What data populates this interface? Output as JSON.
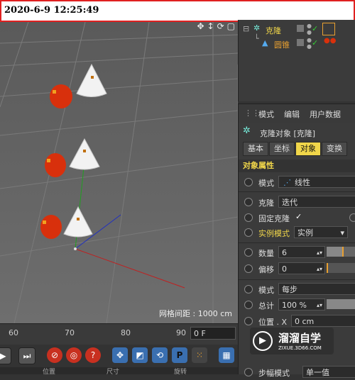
{
  "timestamp": "2020-6-9 12:25:49",
  "viewport": {
    "grid_label": "网格间距 : 1000 cm",
    "icons": [
      "move-view-icon",
      "vertical-arrows-icon",
      "rotate-view-icon",
      "maximize-icon"
    ]
  },
  "timeline": {
    "ticks": [
      "60",
      "70",
      "80",
      "90"
    ],
    "frame": "0 F"
  },
  "playback": {
    "buttons": [
      "record-icon",
      "end-icon",
      "keyframe-red-icon",
      "keyframe-record-icon",
      "help-icon",
      "move-tool-icon",
      "scale-tool-icon",
      "rotate-tool-icon",
      "p-tool-icon",
      "dots-grid-icon",
      "film-icon"
    ]
  },
  "bottom_strip": [
    "位置",
    "尺寸",
    "旋转"
  ],
  "object_manager": {
    "items": [
      {
        "label": "克隆",
        "icon": "cloner-icon"
      },
      {
        "label": "圆锥",
        "icon": "cone-icon"
      }
    ]
  },
  "attr_menu": [
    "模式",
    "编辑",
    "用户数据"
  ],
  "attr_title": "克隆对象 [克隆]",
  "tabs": [
    {
      "label": "基本",
      "active": false
    },
    {
      "label": "坐标",
      "active": false
    },
    {
      "label": "对象",
      "active": true
    },
    {
      "label": "变换",
      "active": false
    }
  ],
  "section_title": "对象属性",
  "props": {
    "mode_label": "模式",
    "mode_value": "线性",
    "clone_label": "克隆",
    "clone_value": "迭代",
    "fixed_label": "固定克隆",
    "fixed_value": "✓",
    "instance_label": "实例模式",
    "instance_value": "实例",
    "count_label": "数量",
    "count_value": "6",
    "offset_label": "偏移",
    "offset_value": "0",
    "mode2_label": "模式",
    "mode2_value": "每步",
    "total_label": "总计",
    "total_value": "100 %",
    "pos_label": "位置 . X",
    "pos_value": "0 cm",
    "step_label": "步幅模式",
    "step_value": "单一值"
  },
  "watermark": {
    "title": "溜溜自学",
    "subtitle": "ZIXUE.3D66.COM"
  },
  "colors": {
    "accent": "#f0d64a",
    "red_border": "#e02020",
    "cone_white": "#f2f2f2",
    "sphere_red": "#d8300c"
  }
}
